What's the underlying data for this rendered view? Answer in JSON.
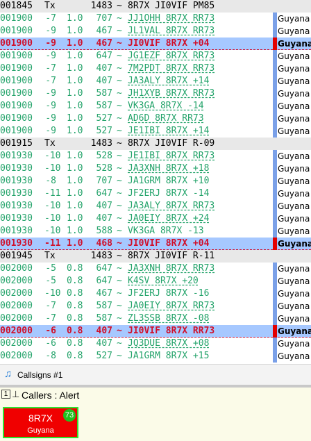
{
  "log_rows": [
    {
      "kind": "tx",
      "time": "001845",
      "mode": "Tx",
      "freq": "1483",
      "tilde": "~",
      "msg": "8R7X JI0VIF PM85"
    },
    {
      "kind": "rx",
      "time": "001900",
      "db": "-7",
      "dt": "1.0",
      "freq": "707",
      "tilde": "~",
      "msg": "JJ1OHH 8R7X RR73",
      "country": "Guyana"
    },
    {
      "kind": "rx",
      "time": "001900",
      "db": "-9",
      "dt": "1.0",
      "freq": "467",
      "tilde": "~",
      "msg": "JL1VAL 8R7X RR73",
      "country": "Guyana"
    },
    {
      "kind": "hl",
      "time": "001900",
      "db": "-9",
      "dt": "1.0",
      "freq": "467",
      "tilde": "~",
      "msg": "JI0VIF 8R7X +04",
      "country": "Guyana"
    },
    {
      "kind": "rx",
      "time": "001900",
      "db": "-9",
      "dt": "1.0",
      "freq": "647",
      "tilde": "~",
      "msg": "JG1EZF 8R7X RR73",
      "country": "Guyana"
    },
    {
      "kind": "rx",
      "time": "001900",
      "db": "-7",
      "dt": "1.0",
      "freq": "407",
      "tilde": "~",
      "msg": "7M2PDT 8R7X RR73",
      "country": "Guyana"
    },
    {
      "kind": "rx",
      "time": "001900",
      "db": "-7",
      "dt": "1.0",
      "freq": "407",
      "tilde": "~",
      "msg": "JA3ALY 8R7X +14",
      "country": "Guyana"
    },
    {
      "kind": "rx",
      "time": "001900",
      "db": "-9",
      "dt": "1.0",
      "freq": "587",
      "tilde": "~",
      "msg": "JH1XYB 8R7X RR73",
      "country": "Guyana"
    },
    {
      "kind": "rx",
      "time": "001900",
      "db": "-9",
      "dt": "1.0",
      "freq": "587",
      "tilde": "~",
      "msg": "VK3GA 8R7X -14",
      "country": "Guyana"
    },
    {
      "kind": "rx",
      "time": "001900",
      "db": "-9",
      "dt": "1.0",
      "freq": "527",
      "tilde": "~",
      "msg": "AD6D 8R7X RR73",
      "country": "Guyana"
    },
    {
      "kind": "rx",
      "time": "001900",
      "db": "-9",
      "dt": "1.0",
      "freq": "527",
      "tilde": "~",
      "msg": "JE1IBI 8R7X +14",
      "country": "Guyana"
    },
    {
      "kind": "tx",
      "time": "001915",
      "mode": "Tx",
      "freq": "1483",
      "tilde": "~",
      "msg": "8R7X JI0VIF R-09"
    },
    {
      "kind": "rx",
      "time": "001930",
      "db": "-10",
      "dt": "1.0",
      "freq": "528",
      "tilde": "~",
      "msg": "JE1IBI 8R7X RR73",
      "country": "Guyana"
    },
    {
      "kind": "rx",
      "time": "001930",
      "db": "-10",
      "dt": "1.0",
      "freq": "528",
      "tilde": "~",
      "msg": "JA3XNH 8R7X +18",
      "country": "Guyana"
    },
    {
      "kind": "rx",
      "time": "001930",
      "db": "-8",
      "dt": "1.0",
      "freq": "707",
      "tilde": "~",
      "msg": "JA1GRM 8R7X +10",
      "country": "Guyana",
      "plain": true
    },
    {
      "kind": "rx",
      "time": "001930",
      "db": "-11",
      "dt": "1.0",
      "freq": "647",
      "tilde": "~",
      "msg": "JF2ERJ 8R7X -14",
      "country": "Guyana",
      "plain": true
    },
    {
      "kind": "rx",
      "time": "001930",
      "db": "-10",
      "dt": "1.0",
      "freq": "407",
      "tilde": "~",
      "msg": "JA3ALY 8R7X RR73",
      "country": "Guyana"
    },
    {
      "kind": "rx",
      "time": "001930",
      "db": "-10",
      "dt": "1.0",
      "freq": "407",
      "tilde": "~",
      "msg": "JA0EIY 8R7X +24",
      "country": "Guyana"
    },
    {
      "kind": "rx",
      "time": "001930",
      "db": "-10",
      "dt": "1.0",
      "freq": "588",
      "tilde": "~",
      "msg": "VK3GA 8R7X -13",
      "country": "Guyana",
      "plain": true
    },
    {
      "kind": "hl",
      "time": "001930",
      "db": "-11",
      "dt": "1.0",
      "freq": "468",
      "tilde": "~",
      "msg": "JI0VIF 8R7X +04",
      "country": "Guyana"
    },
    {
      "kind": "tx",
      "time": "001945",
      "mode": "Tx",
      "freq": "1483",
      "tilde": "~",
      "msg": "8R7X JI0VIF R-11"
    },
    {
      "kind": "rx",
      "time": "002000",
      "db": "-5",
      "dt": "0.8",
      "freq": "647",
      "tilde": "~",
      "msg": "JA3XNH 8R7X RR73",
      "country": "Guyana"
    },
    {
      "kind": "rx",
      "time": "002000",
      "db": "-5",
      "dt": "0.8",
      "freq": "647",
      "tilde": "~",
      "msg": "K4SV 8R7X +20",
      "country": "Guyana"
    },
    {
      "kind": "rx",
      "time": "002000",
      "db": "-10",
      "dt": "0.8",
      "freq": "467",
      "tilde": "~",
      "msg": "JF2ERJ 8R7X -16",
      "country": "Guyana",
      "plain": true
    },
    {
      "kind": "rx",
      "time": "002000",
      "db": "-7",
      "dt": "0.8",
      "freq": "587",
      "tilde": "~",
      "msg": "JA0EIY 8R7X RR73",
      "country": "Guyana"
    },
    {
      "kind": "rx",
      "time": "002000",
      "db": "-7",
      "dt": "0.8",
      "freq": "587",
      "tilde": "~",
      "msg": "ZL3SSB 8R7X -08",
      "country": "Guyana"
    },
    {
      "kind": "hl",
      "time": "002000",
      "db": "-6",
      "dt": "0.8",
      "freq": "407",
      "tilde": "~",
      "msg": "JI0VIF 8R7X RR73",
      "country": "Guyana"
    },
    {
      "kind": "rx",
      "time": "002000",
      "db": "-6",
      "dt": "0.8",
      "freq": "407",
      "tilde": "~",
      "msg": "JQ3DUE 8R7X +08",
      "country": "Guyana"
    },
    {
      "kind": "rx",
      "time": "002000",
      "db": "-8",
      "dt": "0.8",
      "freq": "527",
      "tilde": "~",
      "msg": "JA1GRM 8R7X +15",
      "country": "Guyana",
      "plain": true
    }
  ],
  "callsigns_strip": {
    "icon": "music-note-icon",
    "label": "Callsigns #1"
  },
  "alert_panel": {
    "number": "1",
    "pin_icon": "pin-icon",
    "title": "Callers : Alert"
  },
  "alert_tile": {
    "call": "8R7X",
    "country": "Guyana",
    "snr": "73",
    "color": "#f00000"
  },
  "colors": {
    "rx_text": "#23a36a",
    "highlight_bg": "#a6c8ff",
    "highlight_text": "#d0102b",
    "tx_bg": "#e8e8e8",
    "marker_blue": "#7aa0e8",
    "marker_red": "#e40000"
  }
}
